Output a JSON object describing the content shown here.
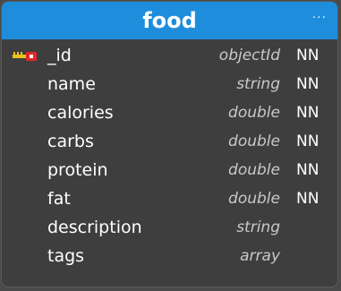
{
  "collection": {
    "title": "food",
    "menu_icon": "ellipsis-icon",
    "menu_label": "···",
    "header_color": "#1e8ddc",
    "fields": [
      {
        "name": "_id",
        "type": "objectId",
        "nn": "NN",
        "pk": true,
        "pk_icon": "key-icon"
      },
      {
        "name": "name",
        "type": "string",
        "nn": "NN"
      },
      {
        "name": "calories",
        "type": "double",
        "nn": "NN"
      },
      {
        "name": "carbs",
        "type": "double",
        "nn": "NN"
      },
      {
        "name": "protein",
        "type": "double",
        "nn": "NN"
      },
      {
        "name": "fat",
        "type": "double",
        "nn": "NN"
      },
      {
        "name": "description",
        "type": "string",
        "nn": ""
      },
      {
        "name": "tags",
        "type": "array",
        "nn": ""
      }
    ]
  }
}
